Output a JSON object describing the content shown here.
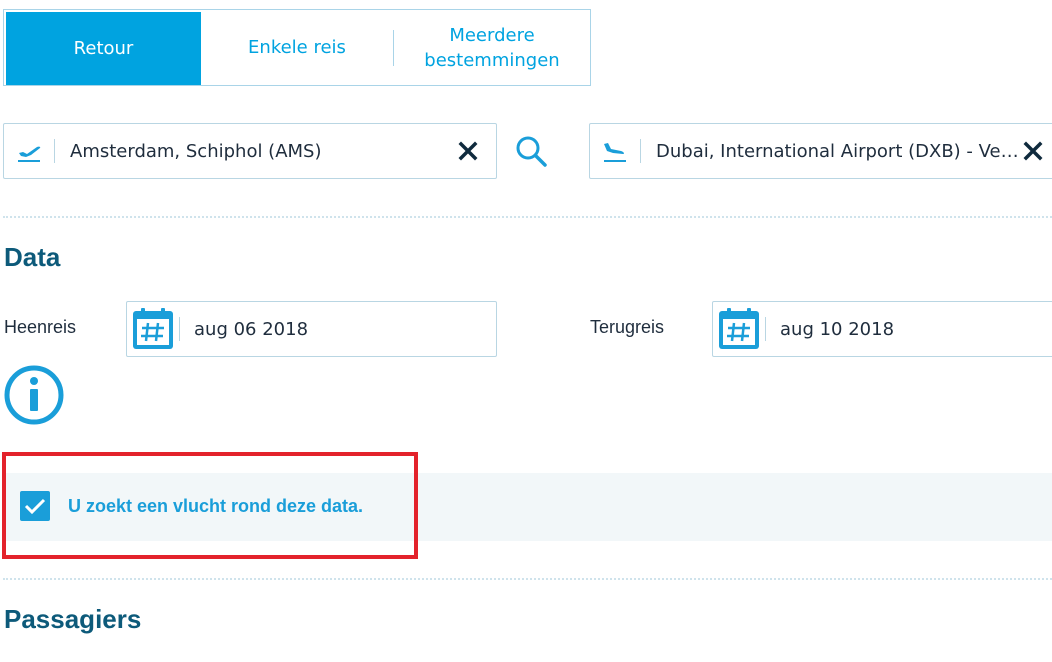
{
  "trip_tabs": [
    {
      "label": "Retour",
      "active": true
    },
    {
      "label": "Enkele reis",
      "active": false
    },
    {
      "label": "Meerdere bestemmingen",
      "active": false
    }
  ],
  "from": {
    "value": "Amsterdam, Schiphol (AMS)",
    "icon": "takeoff-icon",
    "clear_icon": "close-icon"
  },
  "search_icon": "search-icon",
  "to": {
    "value": "Dubai, International Airport (DXB) - Vere...",
    "icon": "landing-icon",
    "clear_icon": "close-icon"
  },
  "dates_section": {
    "title": "Data",
    "outbound_label": "Heenreis",
    "outbound_value": "aug 06 2018",
    "return_label": "Terugreis",
    "return_value": "aug 10 2018",
    "calendar_icon": "calendar-icon",
    "info_icon": "info-icon"
  },
  "flexible": {
    "checked": true,
    "label": "U zoekt een vlucht rond deze data."
  },
  "passengers_section": {
    "title": "Passagiers"
  },
  "colors": {
    "accent": "#00a3e0",
    "heading": "#0d5a7a",
    "highlight": "#e3222b"
  }
}
